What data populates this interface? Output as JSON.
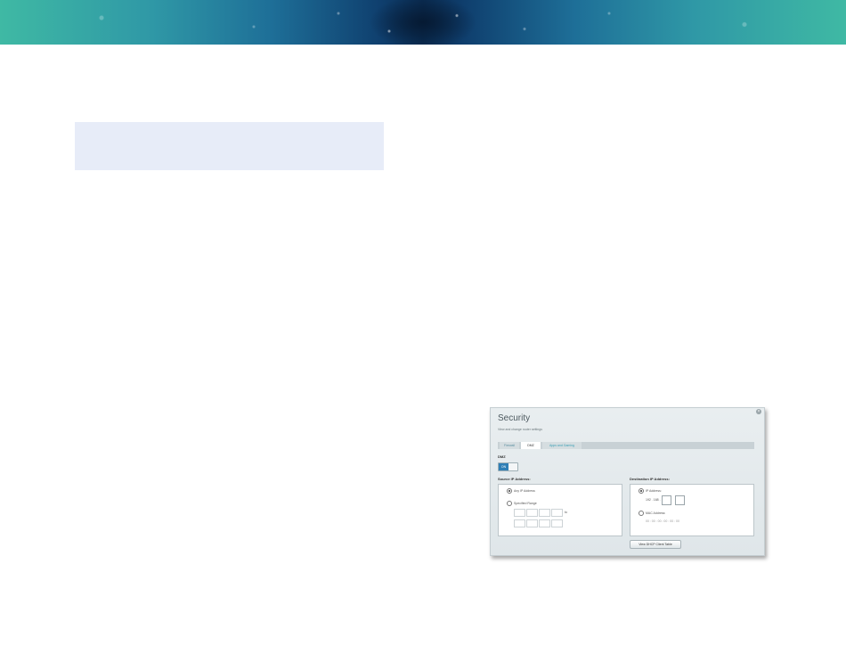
{
  "dialog": {
    "title": "Security",
    "subtitle": "View and change router settings",
    "close_glyph": "×",
    "tabs": [
      "Firewall",
      "DMZ",
      "Apps and Gaming"
    ],
    "dmz_label": "DMZ",
    "toggle_label": "ON",
    "source": {
      "heading": "Source IP Address:",
      "any_label": "Any IP Address",
      "range_label": "Specified Range",
      "to_label": "to"
    },
    "destination": {
      "heading": "Destination IP Address:",
      "ip_label": "IP Address:",
      "ip_prefix": "192 . 168 .",
      "mac_label": "MAC Address:",
      "mac_value": "00 : 00 : 00 : 00 : 00 : 00"
    },
    "dhcp_button": "View DHCP Client Table"
  }
}
